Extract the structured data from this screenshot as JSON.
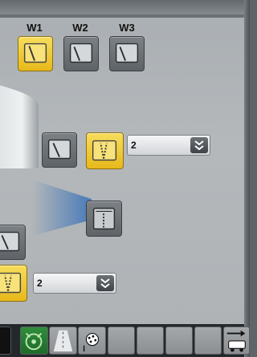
{
  "window_headers": [
    "W1",
    "W2",
    "W3"
  ],
  "selectors": {
    "upper_value": "2",
    "lower_value": "2"
  },
  "colors": {
    "active": "#f2cc33",
    "inactive": "#6b7074",
    "panel": "#b0b4b7"
  },
  "icons": {
    "wiper": "wiper-icon",
    "dropdown": "double-chevron-down-icon",
    "engage": "arrow-to-vehicle-icon"
  }
}
